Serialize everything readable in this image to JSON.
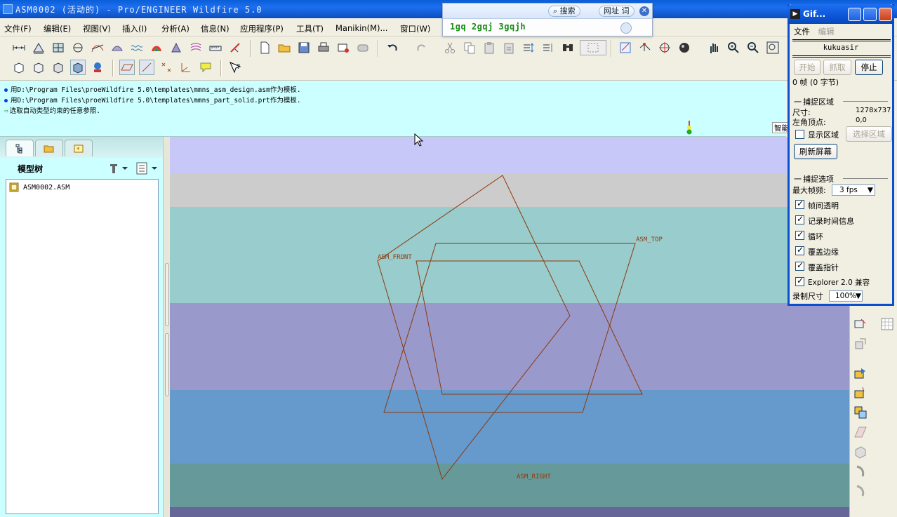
{
  "window": {
    "title": "ASM0002 (活动的) - Pro/ENGINEER Wildfire 5.0"
  },
  "menu": {
    "items": [
      "文件(F)",
      "编辑(E)",
      "视图(V)",
      "插入(I)",
      "分析(A)",
      "信息(N)",
      "应用程序(P)",
      "工具(T)",
      "Manikin(M)...",
      "窗口(W)"
    ]
  },
  "search_popup": {
    "search_label": "搜索",
    "web_label": "网址 词",
    "query": "1gq 2gqj 3gqjh"
  },
  "messages": {
    "lines": [
      "用D:\\Program Files\\proeWildfire 5.0\\templates\\mmns_asm_design.asm作为模板.",
      "用D:\\Program Files\\proeWildfire 5.0\\templates\\mmns_part_solid.prt作为模板.",
      "选取自动类型约束的任意参照."
    ],
    "smart_filter": "智能"
  },
  "model_tree": {
    "title": "模型树",
    "items": [
      "ASM0002.ASM"
    ]
  },
  "planes": {
    "front": "ASM_FRONT",
    "top": "ASM_TOP",
    "right": "ASM_RIGHT"
  },
  "gif_recorder": {
    "title": "Gif...",
    "menu": [
      "文件",
      "编辑"
    ],
    "user": "kukuasir",
    "btn_start": "开始",
    "btn_grab": "抓取",
    "btn_stop": "停止",
    "frames": "0 帧 (0 字节)",
    "section_capture": "捕捉区域",
    "size_label": "尺寸:",
    "size_value": "1278x737",
    "corner_label": "左角顶点:",
    "corner_value": "0,0",
    "show_region": "显示区域",
    "select_region": "选择区域",
    "refresh": "刷新屏幕",
    "section_options": "捕捉选项",
    "max_fps_label": "最大帧频:",
    "max_fps_value": "3 fps",
    "opt_transparent": "帧间透明",
    "opt_time": "记录时间信息",
    "opt_loop": "循环",
    "opt_border": "覆盖边缘",
    "opt_pointer": "覆盖指针",
    "opt_explorer": "Explorer 2.0 兼容",
    "record_size_label": "录制尺寸",
    "record_size_value": "100%"
  },
  "colors": {
    "message_bg": "#ccffff",
    "plane_color": "#8b3a0c",
    "band_1": "#c8c8f8",
    "band_2": "#cccccc",
    "band_3": "#99cccc",
    "band_4": "#9999cc",
    "band_5": "#6699cc",
    "band_6": "#669999"
  }
}
